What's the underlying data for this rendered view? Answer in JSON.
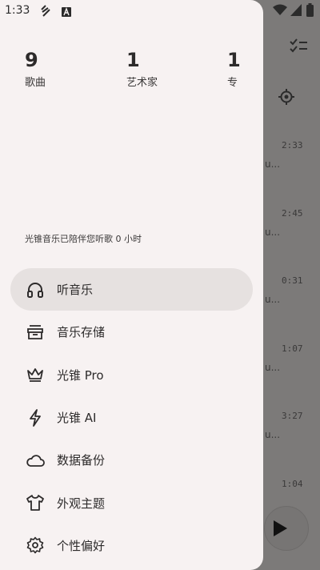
{
  "status_bar": {
    "time": "1:33"
  },
  "drawer": {
    "stats": [
      {
        "value": "9",
        "label": "歌曲"
      },
      {
        "value": "1",
        "label": "艺术家"
      },
      {
        "value": "1",
        "label": "专"
      }
    ],
    "listening_text": "光锥音乐已陪伴您听歌 0 小时",
    "menu": [
      {
        "label": "听音乐",
        "icon": "headphones-icon",
        "active": true
      },
      {
        "label": "音乐存储",
        "icon": "storage-box-icon"
      },
      {
        "label": "光锥 Pro",
        "icon": "crown-icon"
      },
      {
        "label": "光锥 AI",
        "icon": "lightning-icon"
      },
      {
        "label": "数据备份",
        "icon": "cloud-icon"
      },
      {
        "label": "外观主题",
        "icon": "tshirt-icon"
      },
      {
        "label": "个性偏好",
        "icon": "gear-icon"
      }
    ]
  },
  "background": {
    "durations": [
      "2:33",
      "2:45",
      "0:31",
      "1:07",
      "3:27",
      "1:04"
    ],
    "fragment": "u..."
  }
}
